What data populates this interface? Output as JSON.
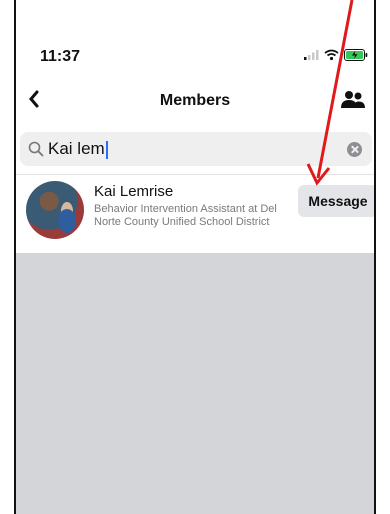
{
  "status_bar": {
    "time": "11:37",
    "icons": [
      "signal-icon",
      "wifi-icon",
      "battery-charging-icon"
    ]
  },
  "header": {
    "title": "Members",
    "back_icon": "chevron-left-icon",
    "action_icon": "people-icon"
  },
  "search": {
    "value": "Kai lem",
    "search_icon": "search-icon",
    "clear_icon": "clear-icon"
  },
  "results": [
    {
      "name": "Kai Lemrise",
      "subtitle": "Behavior Intervention Assistant at Del Norte County Unified School District",
      "button_label": "Message"
    }
  ],
  "annotation": {
    "type": "arrow",
    "color": "#e0191c",
    "points_to": "message-button"
  },
  "colors": {
    "empty_area": "#d3d5d8",
    "search_bg": "#efeff0",
    "button_bg": "#e4e5e8"
  }
}
